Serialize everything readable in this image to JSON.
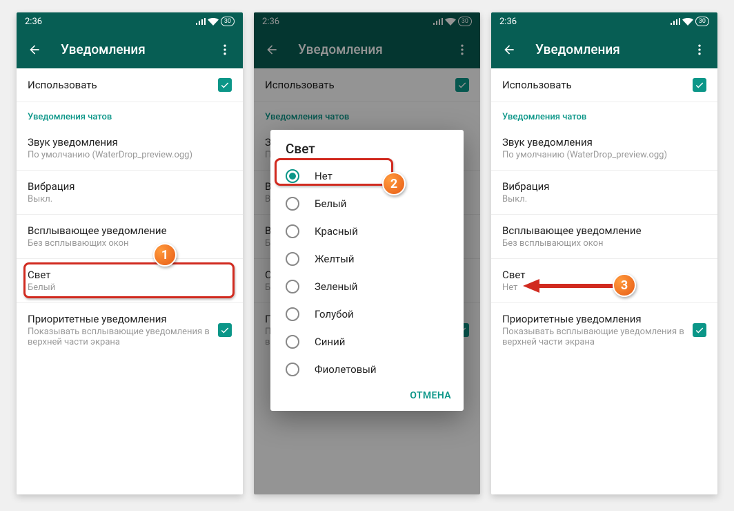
{
  "status": {
    "time": "2:36",
    "battery": "30"
  },
  "appbar": {
    "title": "Уведомления"
  },
  "settings": {
    "use_label": "Использовать",
    "section_chat": "Уведомления чатов",
    "sound_label": "Звук уведомления",
    "sound_value": "По умолчанию (WaterDrop_preview.ogg)",
    "vibration_label": "Вибрация",
    "vibration_value": "Выкл.",
    "popup_label": "Всплывающее уведомление",
    "popup_value": "Без всплывающих окон",
    "light_label": "Свет",
    "light_value_s1": "Белый",
    "light_value_s3": "Нет",
    "priority_label": "Приоритетные уведомления",
    "priority_value": "Показывать всплывающие уведомления в верхней части экрана"
  },
  "dialog": {
    "title": "Свет",
    "options": [
      "Нет",
      "Белый",
      "Красный",
      "Желтый",
      "Зеленый",
      "Голубой",
      "Синий",
      "Фиолетовый"
    ],
    "cancel": "ОТМЕНА"
  },
  "badges": {
    "b1": "1",
    "b2": "2",
    "b3": "3"
  }
}
